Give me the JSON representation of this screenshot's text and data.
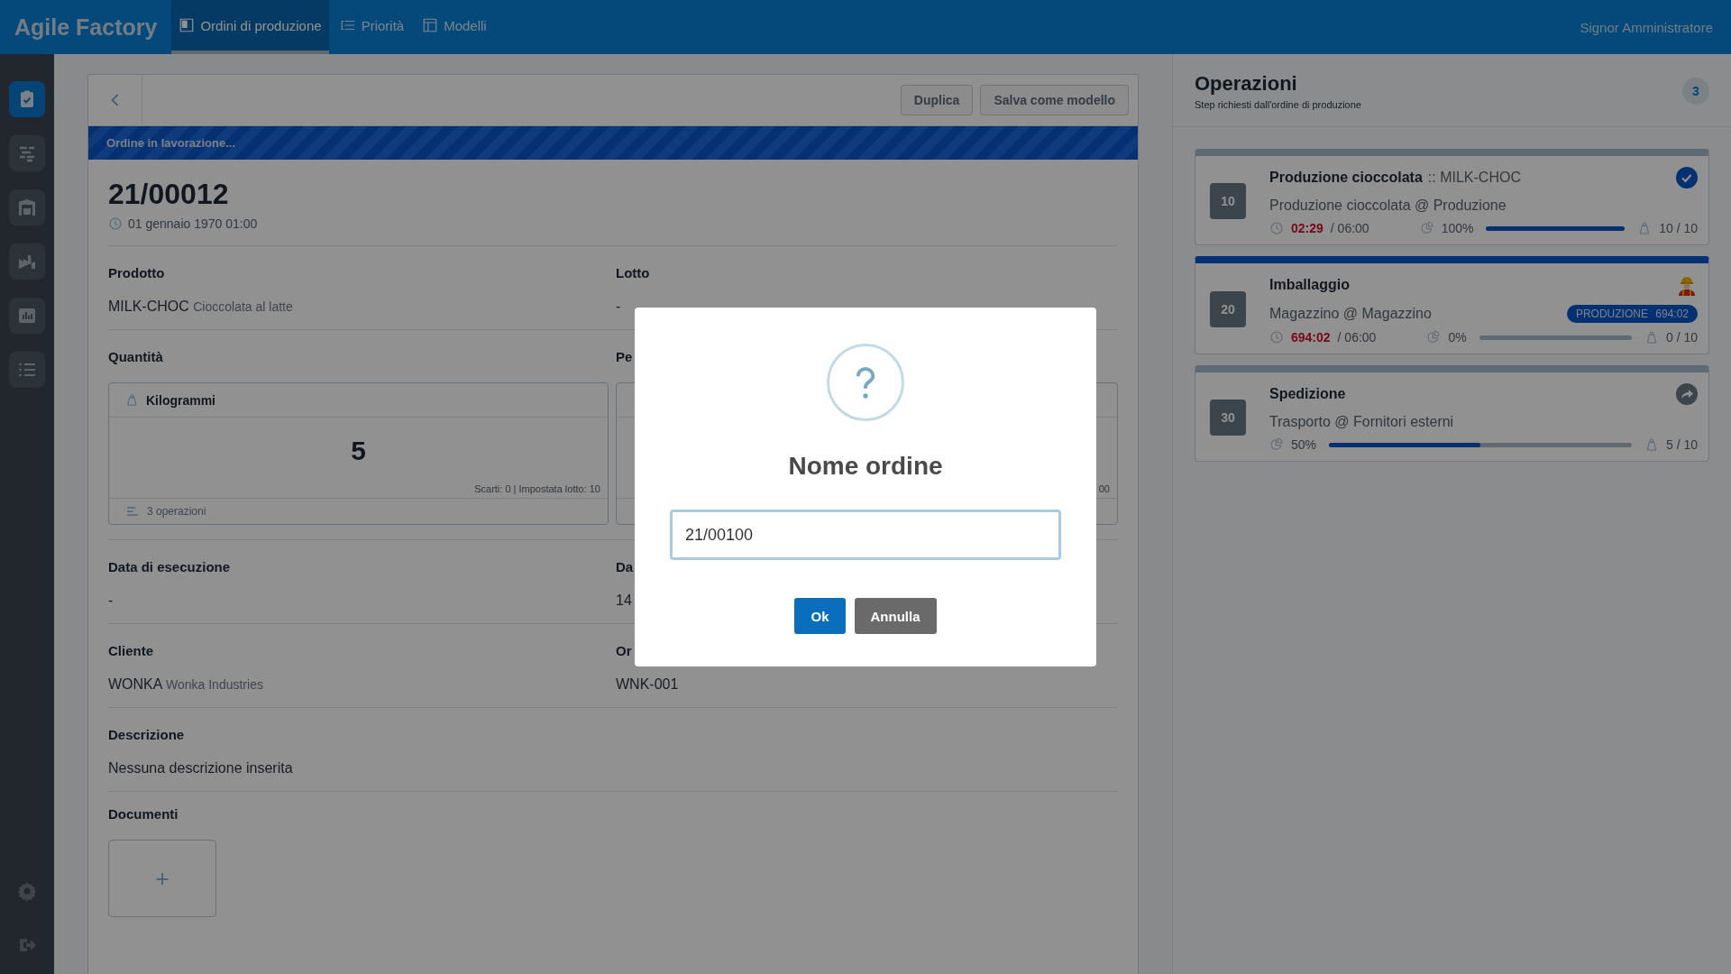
{
  "app": {
    "title": "Agile Factory",
    "nav": [
      {
        "label": "Ordini di produzione",
        "kind": "board",
        "selected": true
      },
      {
        "label": "Priorità",
        "kind": "priority",
        "selected": false
      },
      {
        "label": "Modelli",
        "kind": "template",
        "selected": false
      }
    ],
    "user": "Signor Amministratore"
  },
  "sidebar": {
    "items": [
      {
        "kind": "clipboard",
        "selected": true
      },
      {
        "kind": "gantt",
        "selected": false
      },
      {
        "kind": "warehouse",
        "selected": false
      },
      {
        "kind": "factory",
        "selected": false
      },
      {
        "kind": "chart",
        "selected": false
      },
      {
        "kind": "list",
        "selected": false
      }
    ],
    "bottom": [
      {
        "kind": "settings"
      },
      {
        "kind": "logout"
      }
    ]
  },
  "order": {
    "buttons": [
      "Duplica",
      "Salva come modello"
    ],
    "status": "Ordine in lavorazione...",
    "number": "21/00012",
    "date": "01 gennaio 1970 01:00",
    "rows": [
      [
        {
          "kind": "text",
          "label": "Prodotto",
          "value": "MILK-CHOC",
          "note": "Cioccolata al latte"
        },
        {
          "kind": "text",
          "label": "Lotto",
          "value": "-"
        }
      ],
      [
        {
          "kind": "quantity",
          "label": "Quantità",
          "unit": "Kilogrammi",
          "value": "5",
          "note": "Scarti: 0 | Impostata lotto: 10",
          "footer": "3 operazioni"
        },
        {
          "kind": "quantity",
          "label": "Pe",
          "note": "00"
        }
      ],
      [
        {
          "kind": "text",
          "label": "Data di esecuzione",
          "value": "-"
        },
        {
          "kind": "text",
          "label": "Da",
          "value": "14"
        }
      ],
      [
        {
          "kind": "text",
          "label": "Cliente",
          "value": "WONKA",
          "note": "Wonka Industries"
        },
        {
          "kind": "text",
          "label": "Or",
          "value": "WNK-001"
        }
      ]
    ],
    "description": {
      "label": "Descrizione",
      "value": "Nessuna descrizione inserita"
    },
    "documents": {
      "label": "Documenti",
      "add": "+"
    }
  },
  "operations": {
    "title": "Operazioni",
    "subtitle": "Step richiesti dall'ordine di produzione",
    "count": "3",
    "items": [
      {
        "step": "10",
        "name": "Produzione cioccolata",
        "code": ":: MILK-CHOC",
        "subtitle": "Produzione cioccolata @ Produzione",
        "kind": "done",
        "active": false,
        "time": "02:29",
        "planned": "/ 06:00",
        "percent": "100%",
        "level": 1,
        "pieces": "10 / 10"
      },
      {
        "step": "20",
        "name": "Imballaggio",
        "subtitle": "Magazzino @ Magazzino",
        "kind": "operator",
        "badge": "PRODUZIONE 694:02",
        "active": true,
        "time": "694:02",
        "planned": "/ 06:00",
        "percent": "0%",
        "level": 0,
        "pieces": "0 / 10"
      },
      {
        "step": "30",
        "name": "Spedizione",
        "subtitle": "Trasporto @ Fornitori esterni",
        "kind": "external",
        "active": false,
        "percent": "50%",
        "level": 0.5,
        "pieces": "5 / 10"
      }
    ]
  },
  "dialog": {
    "title": "Nome ordine",
    "value": "21/00100",
    "buttons": [
      {
        "label": "Ok",
        "kind": "primary"
      },
      {
        "label": "Annulla",
        "kind": "secondary"
      }
    ]
  }
}
